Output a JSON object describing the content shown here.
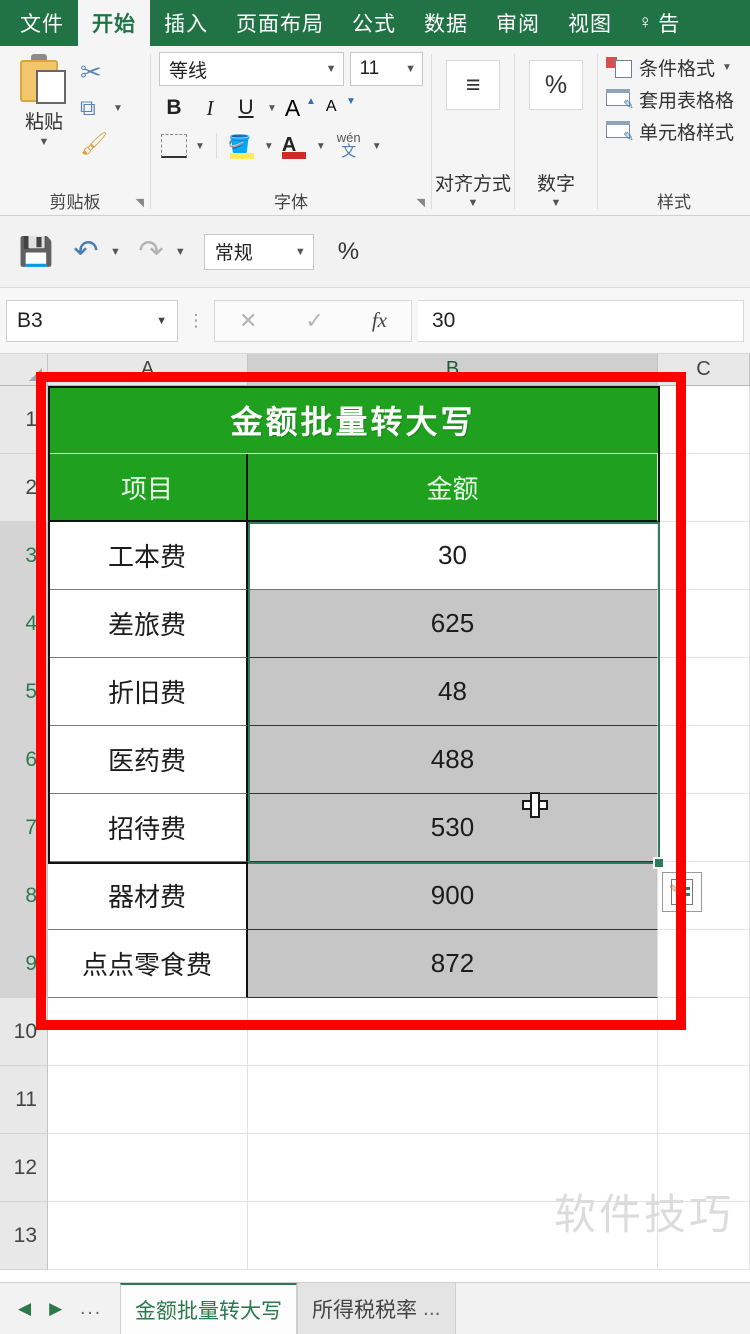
{
  "ribbon": {
    "tabs": [
      {
        "label": "文件",
        "active": false
      },
      {
        "label": "开始",
        "active": true
      },
      {
        "label": "插入",
        "active": false
      },
      {
        "label": "页面布局",
        "active": false
      },
      {
        "label": "公式",
        "active": false
      },
      {
        "label": "数据",
        "active": false
      },
      {
        "label": "审阅",
        "active": false
      },
      {
        "label": "视图",
        "active": false
      }
    ],
    "tellme": "告",
    "clipboard": {
      "paste_label": "粘贴",
      "group_label": "剪贴板",
      "cut_icon": "scissors-icon",
      "copy_icon": "copy-icon",
      "format_painter_icon": "format-painter-icon"
    },
    "font": {
      "group_label": "字体",
      "font_name": "等线",
      "font_size": "11",
      "bold": "B",
      "italic": "I",
      "underline": "U",
      "grow_font": "A",
      "shrink_font": "A",
      "phonetic_top": "wén",
      "phonetic_bottom": "文"
    },
    "alignment": {
      "group_label": "对齐方式"
    },
    "number": {
      "group_label": "数字",
      "glyph": "%"
    },
    "styles": {
      "group_label": "样式",
      "items": [
        {
          "label": "条件格式",
          "has_caret": true
        },
        {
          "label": "套用表格格",
          "has_caret": false
        },
        {
          "label": "单元格样式",
          "has_caret": false
        }
      ]
    }
  },
  "quick_access": {
    "save_icon": "save-icon",
    "undo_icon": "undo-icon",
    "redo_icon": "redo-icon",
    "number_format": "常规",
    "percent_label": "%"
  },
  "formula_bar": {
    "name_box": "B3",
    "cancel": "✕",
    "accept": "✓",
    "fx": "fx",
    "content": "30"
  },
  "grid": {
    "columns": [
      "A",
      "B",
      "C"
    ],
    "selected_column": "B",
    "row_numbers": [
      "1",
      "2",
      "3",
      "4",
      "5",
      "6",
      "7",
      "8",
      "9",
      "10",
      "11",
      "12",
      "13"
    ],
    "selected_rows": [
      "3",
      "4",
      "5",
      "6",
      "7",
      "8",
      "9"
    ]
  },
  "table": {
    "title": "金额批量转大写",
    "headers": [
      "项目",
      "金额"
    ],
    "rows": [
      {
        "row": "3",
        "item": "工本费",
        "amount": "30",
        "active": true
      },
      {
        "row": "4",
        "item": "差旅费",
        "amount": "625",
        "active": false
      },
      {
        "row": "5",
        "item": "折旧费",
        "amount": "48",
        "active": false
      },
      {
        "row": "6",
        "item": "医药费",
        "amount": "488",
        "active": false
      },
      {
        "row": "7",
        "item": "招待费",
        "amount": "530",
        "active": false
      },
      {
        "row": "8",
        "item": "器材费",
        "amount": "900",
        "active": false
      },
      {
        "row": "9",
        "item": "点点零食费",
        "amount": "872",
        "active": false
      }
    ]
  },
  "paste_options": {
    "icon": "paste-options-icon"
  },
  "cursor": {
    "icon": "cell-select-cursor"
  },
  "annotation": {
    "icon": "red-highlight-rectangle",
    "color": "#ff0000"
  },
  "watermark": {
    "text": "软件技巧"
  },
  "sheet_tabs": {
    "prev_icon": "◀",
    "next_icon": "▶",
    "more_icon": "...",
    "tabs": [
      {
        "label": "金额批量转大写",
        "active": true,
        "ellipsis": ""
      },
      {
        "label": "所得税税率",
        "active": false,
        "ellipsis": "..."
      }
    ]
  },
  "colors": {
    "ribbon_green": "#217346",
    "table_green": "#1fa01f",
    "selection_green": "#2e7d5a",
    "annotation_red": "#ff0000"
  }
}
